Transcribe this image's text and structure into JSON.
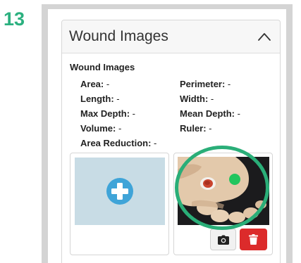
{
  "step_badge": "13",
  "panel": {
    "title": "Wound Images",
    "collapse_icon": "chevron-up-icon"
  },
  "section_label": "Wound Images",
  "metrics": {
    "area": {
      "label": "Area:",
      "value": " -"
    },
    "perimeter": {
      "label": "Perimeter:",
      "value": " -"
    },
    "length": {
      "label": "Length:",
      "value": " -"
    },
    "width": {
      "label": "Width:",
      "value": " -"
    },
    "max_depth": {
      "label": "Max Depth:",
      "value": " -"
    },
    "mean_depth": {
      "label": "Mean Depth:",
      "value": " -"
    },
    "volume": {
      "label": "Volume:",
      "value": " -"
    },
    "ruler": {
      "label": "Ruler:",
      "value": " -"
    },
    "area_reduction": {
      "label": "Area Reduction:",
      "value": " -"
    }
  },
  "tiles": {
    "add_icon": "plus-circle-icon",
    "camera_icon": "camera-icon",
    "delete_icon": "trash-icon"
  },
  "colors": {
    "step_badge": "#2bb07f",
    "highlight_ring": "#2aae78",
    "add_area": "#c8dce5",
    "add_icon": "#3fa4d8",
    "delete_button": "#dc2b2b",
    "marker": "#22c55e"
  }
}
